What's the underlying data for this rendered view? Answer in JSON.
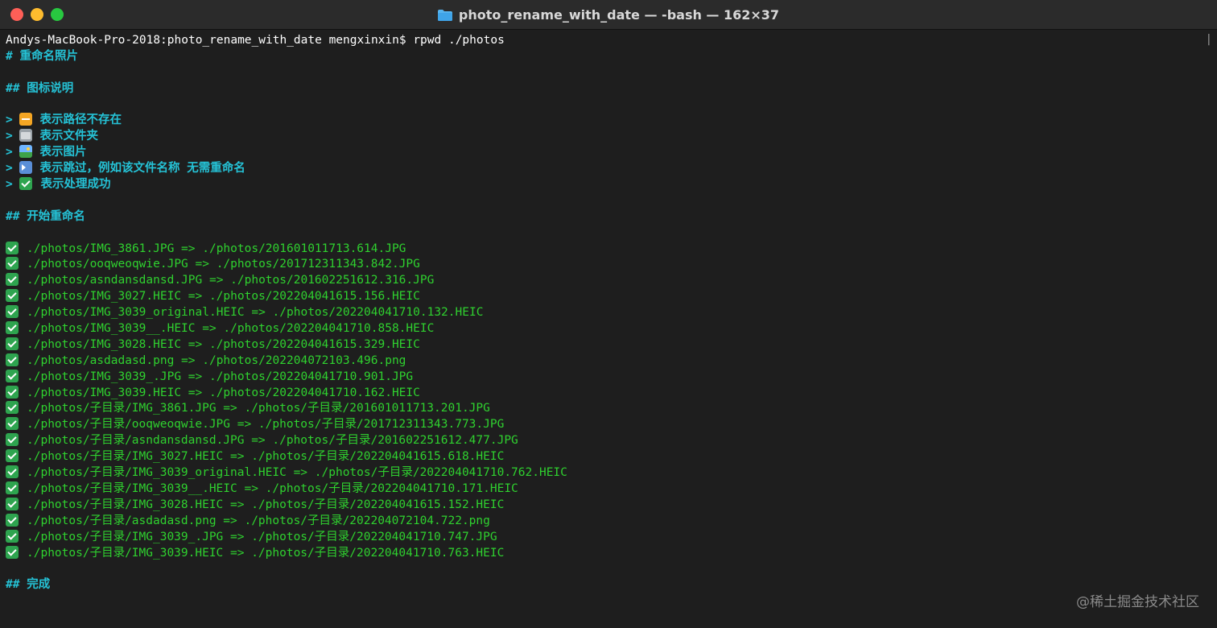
{
  "window": {
    "title": "photo_rename_with_date — -bash — 162×37"
  },
  "terminal": {
    "prompt": "Andys-MacBook-Pro-2018:photo_rename_with_date mengxinxin$ rpwd ./photos",
    "h1": "# 重命名照片",
    "legend_heading": "## 图标说明",
    "legend": [
      {
        "icon": "no-entry-icon",
        "text": "表示路径不存在"
      },
      {
        "icon": "folder-icon",
        "text": "表示文件夹"
      },
      {
        "icon": "picture-icon",
        "text": "表示图片"
      },
      {
        "icon": "skip-forward-icon",
        "text": "表示跳过，例如该文件名称 无需重命名"
      },
      {
        "icon": "check-mark-icon",
        "text": "表示处理成功"
      }
    ],
    "rename_heading": "## 开始重命名",
    "results": [
      "./photos/IMG_3861.JPG => ./photos/201601011713.614.JPG",
      "./photos/ooqweoqwie.JPG => ./photos/201712311343.842.JPG",
      "./photos/asndansdansd.JPG => ./photos/201602251612.316.JPG",
      "./photos/IMG_3027.HEIC => ./photos/202204041615.156.HEIC",
      "./photos/IMG_3039_original.HEIC => ./photos/202204041710.132.HEIC",
      "./photos/IMG_3039__.HEIC => ./photos/202204041710.858.HEIC",
      "./photos/IMG_3028.HEIC => ./photos/202204041615.329.HEIC",
      "./photos/asdadasd.png => ./photos/202204072103.496.png",
      "./photos/IMG_3039_.JPG => ./photos/202204041710.901.JPG",
      "./photos/IMG_3039.HEIC => ./photos/202204041710.162.HEIC",
      "./photos/子目录/IMG_3861.JPG => ./photos/子目录/201601011713.201.JPG",
      "./photos/子目录/ooqweoqwie.JPG => ./photos/子目录/201712311343.773.JPG",
      "./photos/子目录/asndansdansd.JPG => ./photos/子目录/201602251612.477.JPG",
      "./photos/子目录/IMG_3027.HEIC => ./photos/子目录/202204041615.618.HEIC",
      "./photos/子目录/IMG_3039_original.HEIC => ./photos/子目录/202204041710.762.HEIC",
      "./photos/子目录/IMG_3039__.HEIC => ./photos/子目录/202204041710.171.HEIC",
      "./photos/子目录/IMG_3028.HEIC => ./photos/子目录/202204041615.152.HEIC",
      "./photos/子目录/asdadasd.png => ./photos/子目录/202204072104.722.png",
      "./photos/子目录/IMG_3039_.JPG => ./photos/子目录/202204041710.747.JPG",
      "./photos/子目录/IMG_3039.HEIC => ./photos/子目录/202204041710.763.HEIC"
    ],
    "done_heading": "## 完成"
  },
  "watermark": "@稀土掘金技术社区",
  "colors": {
    "background": "#1e1e1e",
    "heading": "#25c2d6",
    "success": "#2fd12f",
    "close": "#fe5f57",
    "minimize": "#febc2e",
    "maximize": "#28c840"
  }
}
